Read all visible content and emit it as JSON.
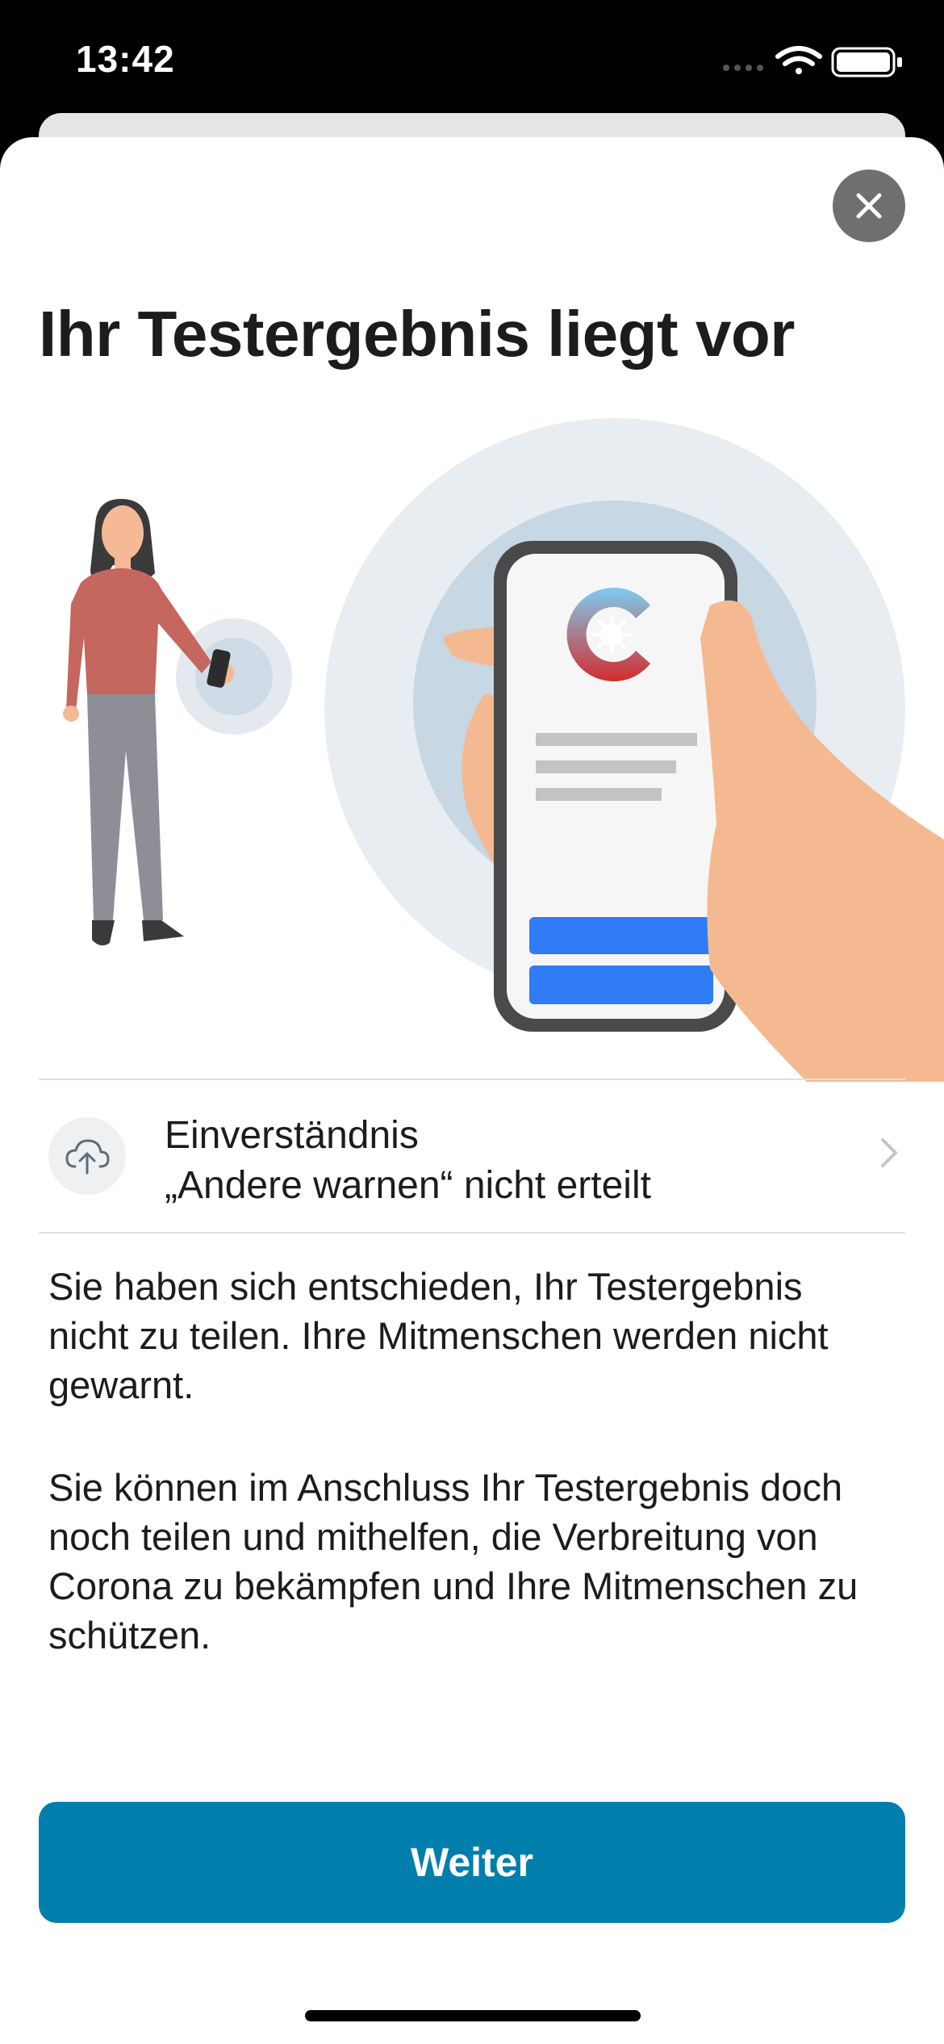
{
  "status_bar": {
    "time": "13:42",
    "icons": [
      "signal-icon",
      "wifi-icon",
      "battery-icon"
    ]
  },
  "sheet": {
    "close_icon": "close-icon",
    "title": "Ihr Testergebnis liegt vor"
  },
  "consent": {
    "icon": "cloud-upload-icon",
    "line1": "Einverständnis",
    "line2": "„Andere warnen“ nicht erteilt",
    "chevron_icon": "chevron-right-icon"
  },
  "body": {
    "paragraph1": "Sie haben sich entschieden, Ihr Testergebnis nicht zu teilen. Ihre Mitmenschen werden nicht gewarnt.",
    "paragraph2": "Sie können im Anschluss Ihr Testergebnis doch noch teilen und mithelfen, die Verbreitung von Corona zu bekämpfen und Ihre Mitmenschen zu schützen."
  },
  "actions": {
    "continue_label": "Weiter"
  },
  "colors": {
    "accent": "#007fad",
    "close_button": "#6f6f6f",
    "phone_button": "#2f7cf6"
  }
}
